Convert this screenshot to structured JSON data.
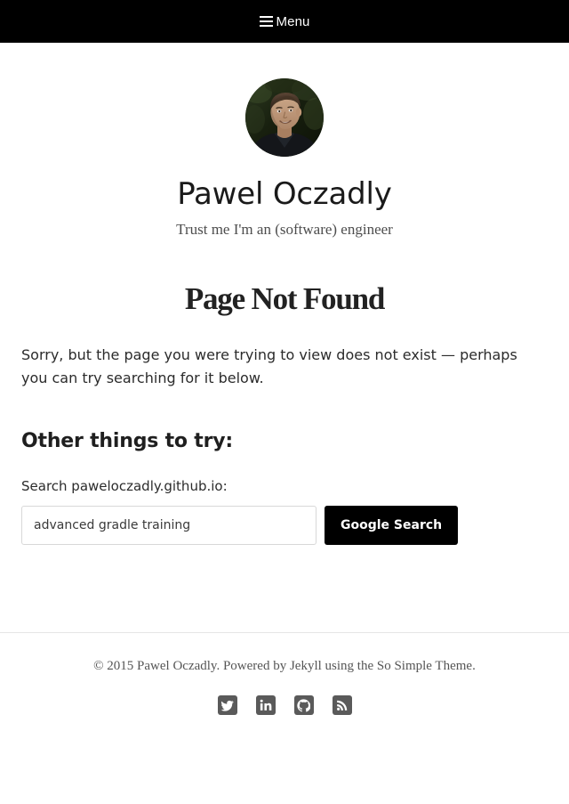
{
  "navbar": {
    "menu_label": "Menu",
    "menu_icon": "hamburger-icon",
    "background_color": "#000000"
  },
  "masthead": {
    "avatar_alt": "Pawel Oczadly portrait photo",
    "site_title": "Pawel Oczadly",
    "site_tagline": "Trust me I'm an (software) engineer"
  },
  "main": {
    "entry_title": "Page Not Found",
    "entry_body": "Sorry, but the page you were trying to view does not exist — perhaps you can try searching for it below.",
    "section_heading": "Other things to try:"
  },
  "search": {
    "label": "Search paweloczadly.github.io:",
    "value": "advanced gradle training",
    "placeholder": "",
    "button_label": "Google Search"
  },
  "footer": {
    "copyright": "© 2015 Pawel Oczadly. Powered by Jekyll using the So Simple Theme.",
    "social_links": [
      {
        "name": "twitter",
        "icon": "twitter-icon"
      },
      {
        "name": "linkedin",
        "icon": "linkedin-icon"
      },
      {
        "name": "github",
        "icon": "github-icon"
      },
      {
        "name": "rss",
        "icon": "rss-icon"
      }
    ]
  },
  "colors": {
    "nav_background": "#000000",
    "button_background": "#000000",
    "social_icon_background": "#5a5a5a",
    "divider": "#e6e6e6",
    "text_primary": "#2b2b2b",
    "text_muted": "#555555"
  }
}
